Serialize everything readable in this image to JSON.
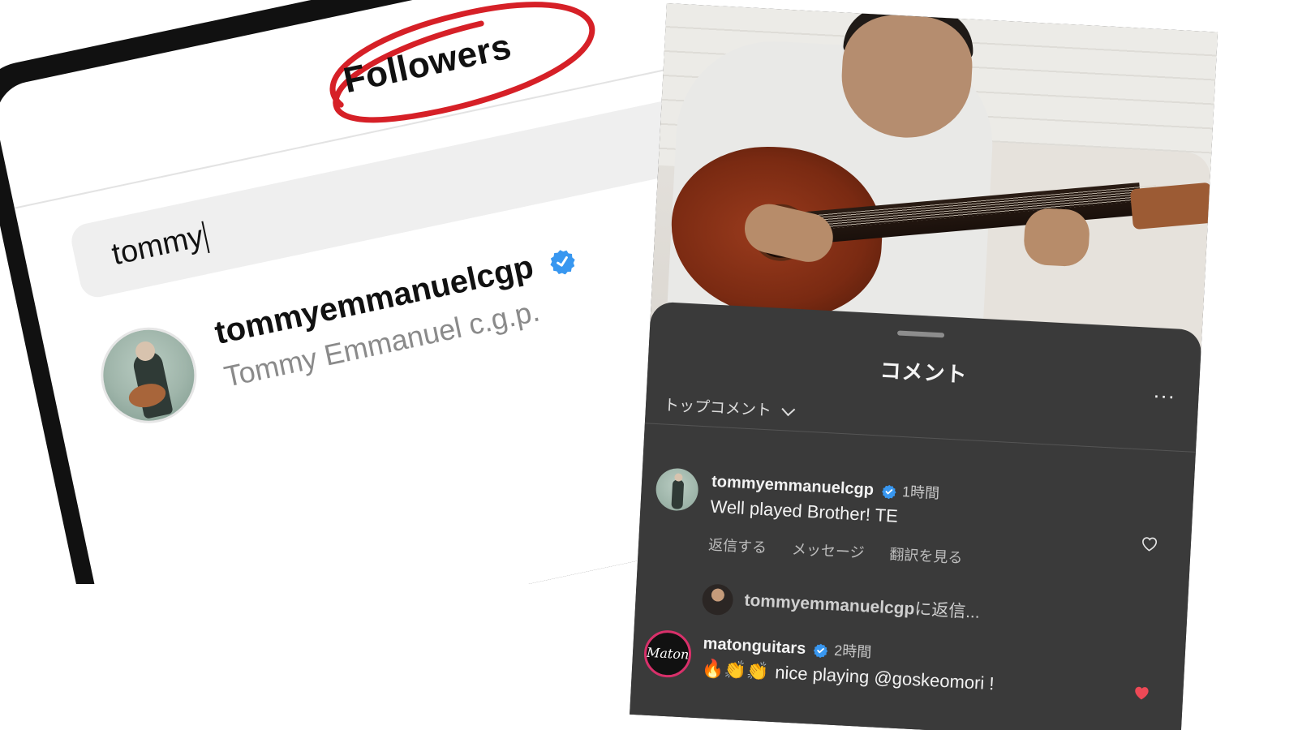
{
  "left_panel": {
    "header_title": "Followers",
    "search": {
      "value": "tommy"
    },
    "result": {
      "username": "tommyemmanuelcgp",
      "full_name": "Tommy Emmanuel c.g.p.",
      "verified": true
    },
    "highlight_color": "#d62027"
  },
  "right_panel": {
    "sheet_title": "コメント",
    "more_label": "...",
    "sort_label": "トップコメント",
    "comments": [
      {
        "username": "tommyemmanuelcgp",
        "verified": true,
        "time": "1時間",
        "text": "Well played Brother! TE",
        "actions": [
          "返信する",
          "メッセージ",
          "翻訳を見る"
        ],
        "liked": false
      },
      {
        "username": "matonguitars",
        "verified": true,
        "time": "2時間",
        "emojis": "🔥👏👏",
        "text": "nice playing @goskeomori !",
        "avatar_text": "Maton",
        "liked": true
      }
    ],
    "reply": {
      "username": "tommyemmanuelcgp",
      "suffix": "に返信..."
    },
    "colors": {
      "sheet_bg": "#3a3a3a",
      "verified_blue": "#3897f0",
      "like_red": "#ed4956"
    }
  }
}
